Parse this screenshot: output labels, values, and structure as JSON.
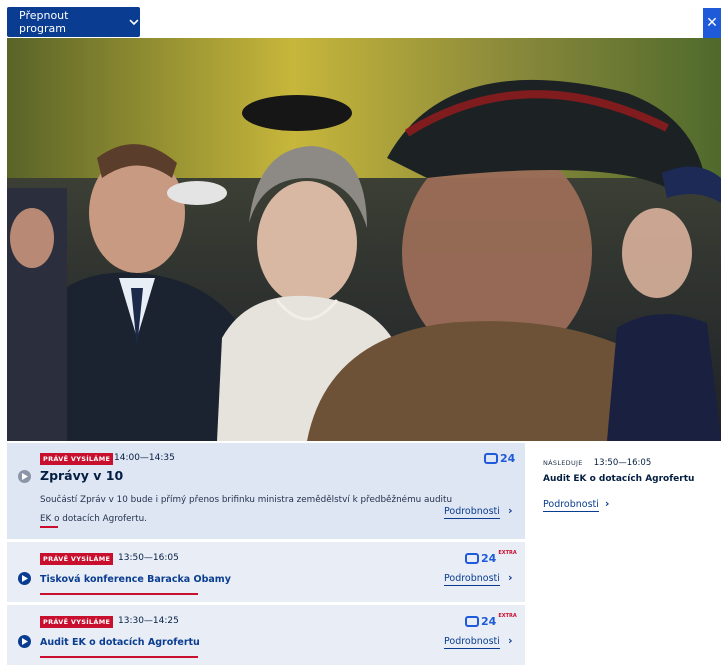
{
  "header": {
    "switch_label": "Přepnout program",
    "close_glyph": "✕"
  },
  "programs": [
    {
      "badge": "PRÁVĚ VYSÍLÁME",
      "time": "14:00—14:35",
      "title": "Zprávy v 10",
      "description": "Součástí Zpráv v 10 bude i přímý přenos brifinku ministra zemědělství k předběžnému auditu EK o dotacích Agrofertu.",
      "channel": "24",
      "channel_extra": "",
      "details_label": "Podrobnosti",
      "progress": 0.04
    },
    {
      "badge": "PRÁVĚ VYSÍLÁME",
      "time": "13:50—16:05",
      "title": "Tisková konference Baracka Obamy",
      "channel": "24",
      "channel_extra": "EXTRA",
      "details_label": "Podrobnosti",
      "progress": 0.35
    },
    {
      "badge": "PRÁVĚ VYSÍLÁME",
      "time": "13:30—14:25",
      "title": "Audit EK o dotacích Agrofertu",
      "channel": "24",
      "channel_extra": "EXTRA",
      "details_label": "Podrobnosti",
      "progress": 0.35
    }
  ],
  "next": {
    "label": "NÁSLEDUJE",
    "time": "13:50—16:05",
    "title": "Audit EK o dotacích Agrofertu",
    "details_label": "Podrobnosti"
  },
  "colors": {
    "accent": "#0a3d91",
    "live": "#c8102e",
    "channel_logo": "#1f5bd9"
  }
}
